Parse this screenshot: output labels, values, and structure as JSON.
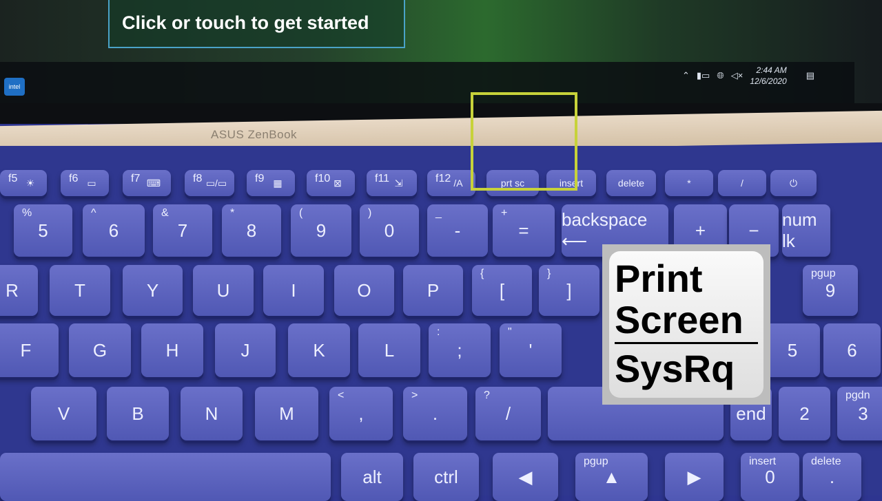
{
  "screen": {
    "banner": "Click or touch to get started",
    "intel_label": "intel",
    "tray": {
      "icons": [
        "chevron-up-icon",
        "battery-icon",
        "globe-icon",
        "mute-icon"
      ],
      "time": "2:44 AM",
      "date": "12/6/2020",
      "notification_icon": "notification-icon"
    }
  },
  "brand": "ASUS ZenBook",
  "keys": {
    "fn": [
      [
        "f5",
        "☀"
      ],
      [
        "f6",
        "▭"
      ],
      [
        "f7",
        "⌨"
      ],
      [
        "f8",
        "▭/▭"
      ],
      [
        "f9",
        "▦"
      ],
      [
        "f10",
        "⊠"
      ],
      [
        "f11",
        "⇲"
      ],
      [
        "f12",
        "/A"
      ],
      [
        "",
        "prt sc"
      ],
      [
        "",
        "insert"
      ],
      [
        "",
        "delete"
      ],
      [
        "",
        "*"
      ],
      [
        "",
        "/"
      ],
      [
        "",
        "⏻"
      ]
    ],
    "num": [
      [
        "%",
        "5"
      ],
      [
        "^",
        "6"
      ],
      [
        "&",
        "7"
      ],
      [
        "*",
        "8"
      ],
      [
        "(",
        "9"
      ],
      [
        ")",
        "0"
      ],
      [
        "_",
        "-"
      ],
      [
        "+",
        "="
      ],
      [
        "",
        "backspace ⟵"
      ],
      [
        "",
        "+"
      ],
      [
        "",
        "−"
      ],
      [
        "",
        "num lk"
      ]
    ],
    "top": [
      [
        "",
        "R"
      ],
      [
        "",
        "T"
      ],
      [
        "",
        "Y"
      ],
      [
        "",
        "U"
      ],
      [
        "",
        "I"
      ],
      [
        "",
        "O"
      ],
      [
        "",
        "P"
      ],
      [
        "{",
        "["
      ],
      [
        "}",
        "]"
      ],
      [
        "pgup",
        "9"
      ]
    ],
    "home": [
      [
        "",
        "F"
      ],
      [
        "",
        "G"
      ],
      [
        "",
        "H"
      ],
      [
        "",
        "J"
      ],
      [
        "",
        "K"
      ],
      [
        "",
        "L"
      ],
      [
        ":",
        ";"
      ],
      [
        "\"",
        "'"
      ],
      [
        "",
        "5"
      ],
      [
        "",
        "6"
      ]
    ],
    "bottom": [
      [
        "",
        "V"
      ],
      [
        "",
        "B"
      ],
      [
        "",
        "N"
      ],
      [
        "",
        "M"
      ],
      [
        "<",
        ","
      ],
      [
        ">",
        "."
      ],
      [
        "?",
        "/"
      ],
      [
        "",
        ""
      ],
      [
        "",
        "end"
      ],
      [
        "",
        "2"
      ],
      [
        "pgdn",
        "3"
      ]
    ],
    "last": [
      [
        "",
        ""
      ],
      [
        "",
        "alt"
      ],
      [
        "",
        "ctrl"
      ],
      [
        "",
        "◀"
      ],
      [
        "pgup",
        "▲"
      ],
      [
        "",
        "▶"
      ],
      [
        "insert",
        "0"
      ],
      [
        "delete",
        "."
      ]
    ]
  },
  "overlay": {
    "line1": "Print",
    "line2": "Screen",
    "line3": "SysRq"
  },
  "highlight_color": "#c7d23a"
}
